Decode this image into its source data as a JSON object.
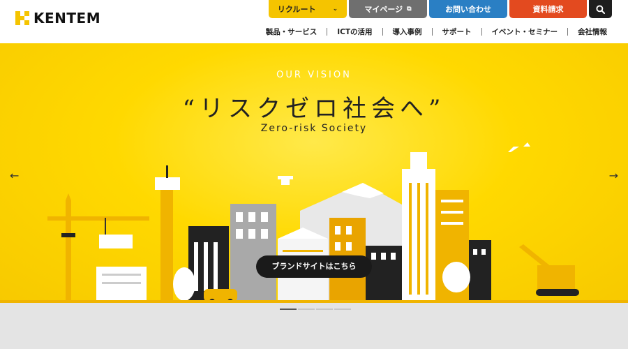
{
  "brand": {
    "logo_text": "KENTEM",
    "accent": "#f5c400"
  },
  "top_buttons": {
    "recruit": "リクルート",
    "mypage": "マイページ",
    "contact": "お問い合わせ",
    "docs": "資料請求",
    "search_icon": "search-icon"
  },
  "nav": {
    "items": [
      "製品・サービス",
      "ICTの活用",
      "導入事例",
      "サポート",
      "イベント・セミナー",
      "会社情報"
    ]
  },
  "hero": {
    "subtitle": "OUR VISION",
    "title": "“リスクゼロ社会へ”",
    "english": "Zero-risk Society",
    "cta": "ブランドサイトはこちら"
  },
  "carousel": {
    "slides": 4,
    "active": 1
  }
}
